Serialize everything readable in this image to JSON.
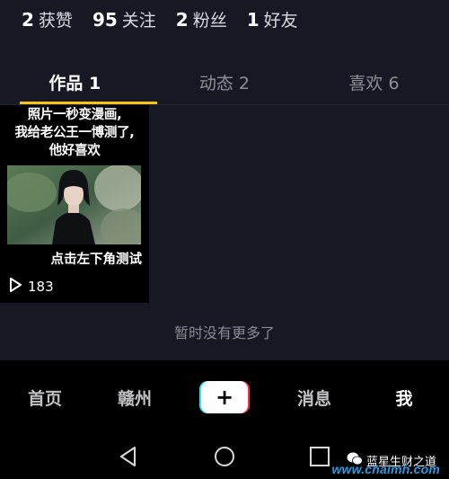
{
  "stats": [
    {
      "value": "2",
      "label": "获赞"
    },
    {
      "value": "95",
      "label": "关注"
    },
    {
      "value": "2",
      "label": "粉丝"
    },
    {
      "value": "1",
      "label": "好友"
    }
  ],
  "tabs": [
    {
      "label": "作品 1",
      "active": true
    },
    {
      "label": "动态 2",
      "active": false
    },
    {
      "label": "喜欢 6",
      "active": false
    }
  ],
  "video": {
    "caption_lines": [
      "照片一秒变漫画,",
      "我给老公王一博测了,",
      "他好喜欢"
    ],
    "subtitle": "点击左下角测试",
    "play_count": "183",
    "play_icon": "play-outline-icon"
  },
  "no_more_text": "暂时没有更多了",
  "bottom_nav": {
    "items": [
      "首页",
      "赣州",
      "+",
      "消息",
      "我"
    ],
    "active_index": 4
  },
  "system_nav": {
    "back_icon": "triangle-back-icon",
    "home_icon": "circle-home-icon",
    "recent_icon": "square-recent-icon"
  },
  "watermark": {
    "text": "蓝星生财之道",
    "url": "www.chalmh.com",
    "icon": "wechat-icon"
  },
  "colors": {
    "background": "#161823",
    "tab_underline": "#f5c414",
    "plus_cyan": "#2fe6ee",
    "plus_pink": "#fe2c55",
    "watermark_url": "#2a9be3"
  }
}
